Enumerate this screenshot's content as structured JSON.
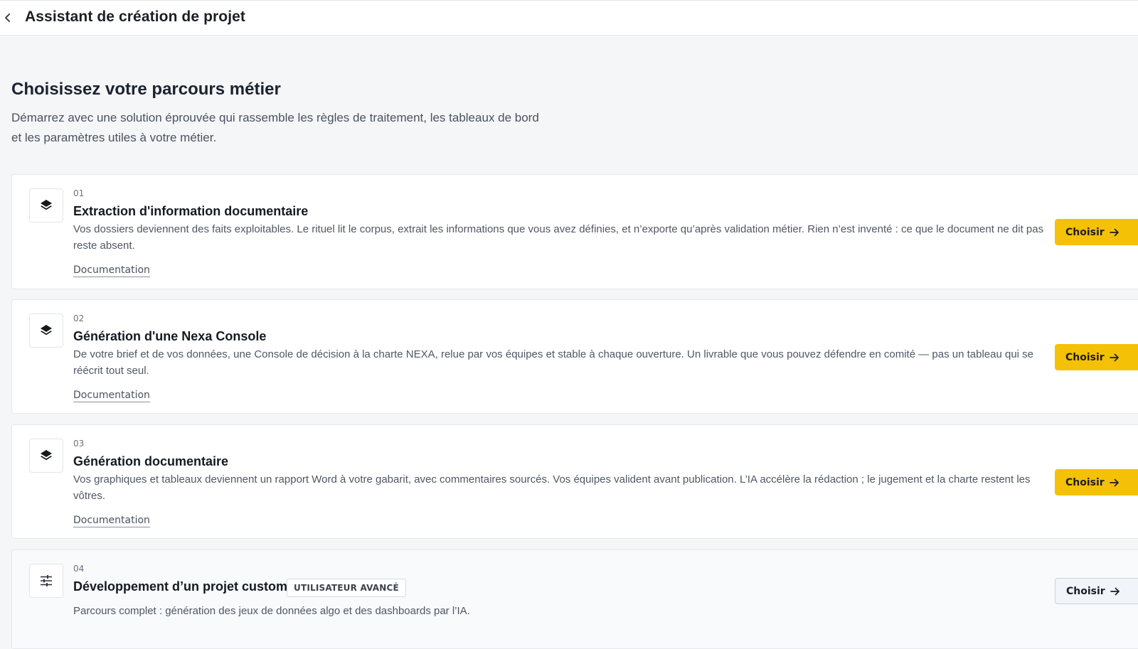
{
  "header": {
    "back_icon": "chevron-left-icon",
    "title": "Assistant de création de projet"
  },
  "intro": {
    "title": "Choisissez votre parcours métier",
    "description": "Démarrez avec une solution éprouvée qui rassemble les règles de traitement, les tableaux de bord et les paramètres utiles à votre métier."
  },
  "cards": [
    {
      "number": "01",
      "icon": "layers-icon",
      "title": "Extraction d'information documentaire",
      "description": "Vos dossiers deviennent des faits exploitables. Le rituel lit le corpus, extrait les informations que vous avez définies, et n’exporte qu’après validation métier. Rien n’est inventé : ce que le document ne dit pas reste absent.",
      "doc_link": "Documentation",
      "button": "Choisir"
    },
    {
      "number": "02",
      "icon": "layers-icon",
      "title": "Génération d'une Nexa Console",
      "description": "De votre brief et de vos données, une Console de décision à la charte NEXA, relue par vos équipes et stable à chaque ouverture. Un livrable que vous pouvez défendre en comité — pas un tableau qui se réécrit tout seul.",
      "doc_link": "Documentation",
      "button": "Choisir"
    },
    {
      "number": "03",
      "icon": "layers-icon",
      "title": "Génération documentaire",
      "description": "Vos graphiques et tableaux deviennent un rapport Word à votre gabarit, avec commentaires sourcés. Vos équipes valident avant publication. L’IA accélère la rédaction ; le jugement et la charte restent les vôtres.",
      "doc_link": "Documentation",
      "button": "Choisir"
    },
    {
      "number": "04",
      "icon": "sliders-icon",
      "title": "Développement d’un projet custom",
      "badge": "UTILISATEUR AVANCÉ",
      "description": "Parcours complet : génération des jeux de données algo et des dashboards par l’IA.",
      "button": "Choisir"
    }
  ],
  "colors": {
    "accent": "#f5c107",
    "background": "#f5f6f7"
  }
}
